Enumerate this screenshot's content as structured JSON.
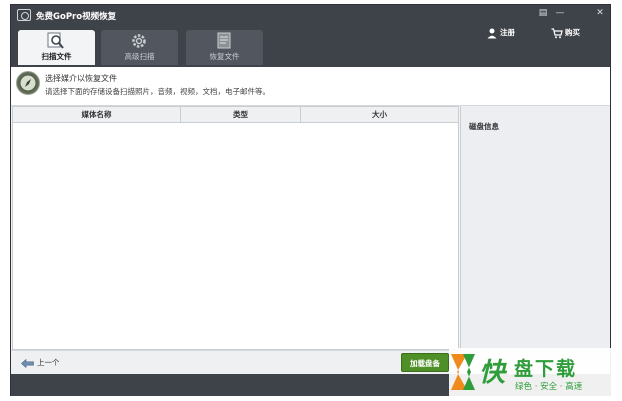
{
  "window": {
    "title": "免费GoPro视频恢复",
    "controls": [
      "▤",
      "—",
      "✕"
    ]
  },
  "tabs": [
    {
      "label": "扫描文件",
      "icon": "magnifier-icon",
      "active": true
    },
    {
      "label": "高级扫描",
      "icon": "gear-icon",
      "active": false
    },
    {
      "label": "恢复文件",
      "icon": "document-icon",
      "active": false
    }
  ],
  "account": {
    "register_label": "注册",
    "buy_label": "购买"
  },
  "info": {
    "title": "选择媒介以恢复文件",
    "subtitle": "请选择下面的存储设备扫描照片，音频，视频，文档，电子邮件等。"
  },
  "table": {
    "columns": [
      "媒体名称",
      "类型",
      "大小"
    ],
    "rows": []
  },
  "side_panel": {
    "title": "磁盘信息"
  },
  "footer": {
    "prev_label": "上一个",
    "load_button_label": "加载盘备"
  },
  "watermark": {
    "brand_text": "盘下载",
    "slogan": "绿色 · 安全 · 高速"
  },
  "colors": {
    "titlebar": "#3e4249",
    "button_green": "#4e8f28",
    "watermark_orange": "#f08a1a",
    "watermark_green": "#2e9d3a"
  }
}
